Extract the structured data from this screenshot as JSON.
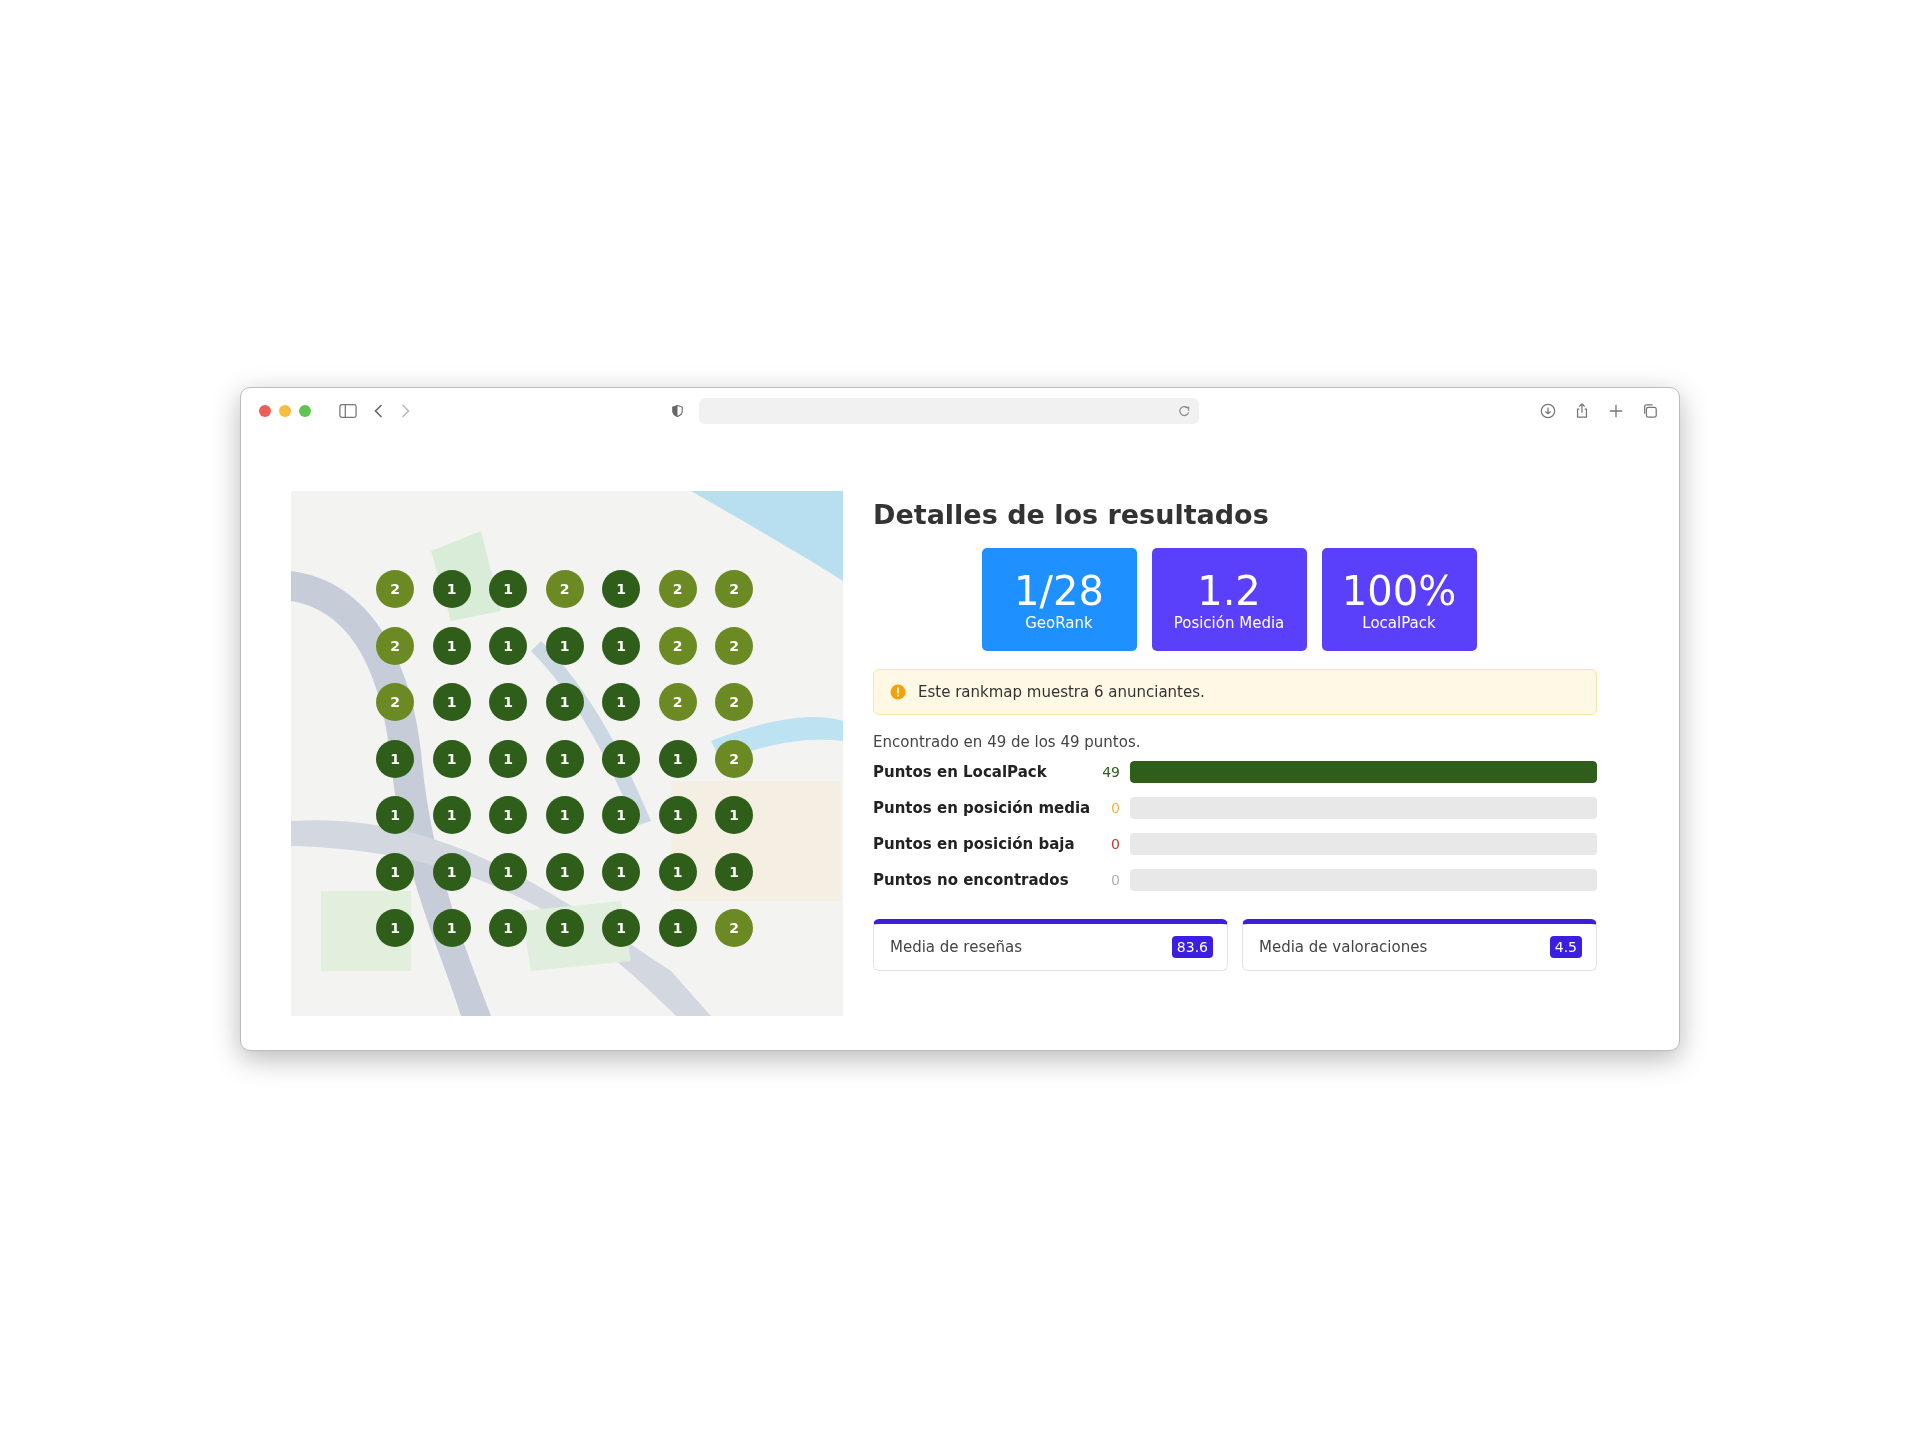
{
  "map": {
    "grid": [
      [
        {
          "rank": "2",
          "color": "#6b8a23"
        },
        {
          "rank": "1",
          "color": "#2f5e1a"
        },
        {
          "rank": "1",
          "color": "#2f5e1a"
        },
        {
          "rank": "2",
          "color": "#6b8a23"
        },
        {
          "rank": "1",
          "color": "#2f5e1a"
        },
        {
          "rank": "2",
          "color": "#6b8a23"
        },
        {
          "rank": "2",
          "color": "#6b8a23"
        }
      ],
      [
        {
          "rank": "2",
          "color": "#6b8a23"
        },
        {
          "rank": "1",
          "color": "#2f5e1a"
        },
        {
          "rank": "1",
          "color": "#2f5e1a"
        },
        {
          "rank": "1",
          "color": "#2f5e1a"
        },
        {
          "rank": "1",
          "color": "#2f5e1a"
        },
        {
          "rank": "2",
          "color": "#6b8a23"
        },
        {
          "rank": "2",
          "color": "#6b8a23"
        }
      ],
      [
        {
          "rank": "2",
          "color": "#6b8a23"
        },
        {
          "rank": "1",
          "color": "#2f5e1a"
        },
        {
          "rank": "1",
          "color": "#2f5e1a"
        },
        {
          "rank": "1",
          "color": "#2f5e1a"
        },
        {
          "rank": "1",
          "color": "#2f5e1a"
        },
        {
          "rank": "2",
          "color": "#6b8a23"
        },
        {
          "rank": "2",
          "color": "#6b8a23"
        }
      ],
      [
        {
          "rank": "1",
          "color": "#2f5e1a"
        },
        {
          "rank": "1",
          "color": "#2f5e1a"
        },
        {
          "rank": "1",
          "color": "#2f5e1a"
        },
        {
          "rank": "1",
          "color": "#2f5e1a"
        },
        {
          "rank": "1",
          "color": "#2f5e1a"
        },
        {
          "rank": "1",
          "color": "#2f5e1a"
        },
        {
          "rank": "2",
          "color": "#6b8a23"
        }
      ],
      [
        {
          "rank": "1",
          "color": "#2f5e1a"
        },
        {
          "rank": "1",
          "color": "#2f5e1a"
        },
        {
          "rank": "1",
          "color": "#2f5e1a"
        },
        {
          "rank": "1",
          "color": "#2f5e1a"
        },
        {
          "rank": "1",
          "color": "#2f5e1a"
        },
        {
          "rank": "1",
          "color": "#2f5e1a"
        },
        {
          "rank": "1",
          "color": "#2f5e1a"
        }
      ],
      [
        {
          "rank": "1",
          "color": "#2f5e1a"
        },
        {
          "rank": "1",
          "color": "#2f5e1a"
        },
        {
          "rank": "1",
          "color": "#2f5e1a"
        },
        {
          "rank": "1",
          "color": "#2f5e1a"
        },
        {
          "rank": "1",
          "color": "#2f5e1a"
        },
        {
          "rank": "1",
          "color": "#2f5e1a"
        },
        {
          "rank": "1",
          "color": "#2f5e1a"
        }
      ],
      [
        {
          "rank": "1",
          "color": "#2f5e1a"
        },
        {
          "rank": "1",
          "color": "#2f5e1a"
        },
        {
          "rank": "1",
          "color": "#2f5e1a"
        },
        {
          "rank": "1",
          "color": "#2f5e1a"
        },
        {
          "rank": "1",
          "color": "#2f5e1a"
        },
        {
          "rank": "1",
          "color": "#2f5e1a"
        },
        {
          "rank": "2",
          "color": "#6b8a23"
        }
      ]
    ]
  },
  "title": "Detalles de los resultados",
  "kpis": [
    {
      "value": "1/28",
      "label": "GeoRank",
      "color": "#1e90ff"
    },
    {
      "value": "1.2",
      "label": "Posición Media",
      "color": "#5b40fb"
    },
    {
      "value": "100%",
      "label": "LocalPack",
      "color": "#5b40fb"
    }
  ],
  "alert": "Este rankmap muestra 6 anunciantes.",
  "summary": "Encontrado en 49 de los 49 puntos.",
  "stats": [
    {
      "label": "Puntos en LocalPack",
      "count": "49",
      "color": "#2f5e1a",
      "level": 1
    },
    {
      "label": "Puntos en posición media",
      "count": "0",
      "color": "#f5b342"
    },
    {
      "label": "Puntos en posición baja",
      "count": "0",
      "color": "#c0392b"
    },
    {
      "label": "Puntos no encontrados",
      "count": "0",
      "color": "#aab4c0"
    }
  ],
  "averages": [
    {
      "label": "Media de reseñas",
      "value": "83.6"
    },
    {
      "label": "Media de valoraciones",
      "value": "4.5"
    }
  ]
}
